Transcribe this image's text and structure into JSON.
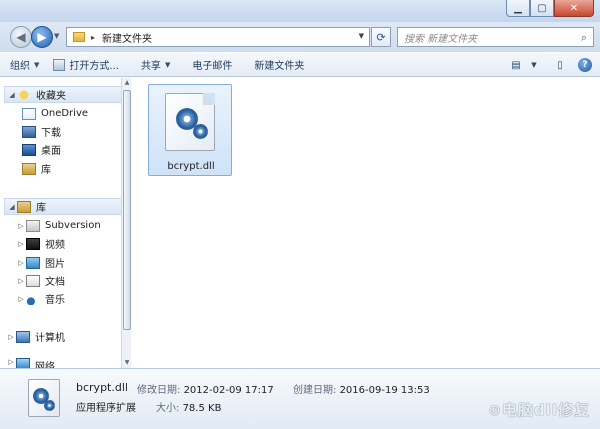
{
  "window": {
    "min_icon": "minimize-icon",
    "max_icon": "maximize-icon",
    "close_icon": "close-icon"
  },
  "nav": {
    "back_icon": "back-arrow-icon",
    "forward_icon": "forward-arrow-icon",
    "address": "新建文件夹",
    "search_placeholder": "搜索 新建文件夹"
  },
  "toolbar": {
    "organize": "组织",
    "open_with": "打开方式...",
    "share": "共享",
    "email": "电子邮件",
    "new_folder": "新建文件夹"
  },
  "sidebar": {
    "favorites_header": "收藏夹",
    "favorites": [
      "OneDrive",
      "下载",
      "桌面",
      "库"
    ],
    "libraries_header": "库",
    "libraries": [
      "Subversion",
      "视频",
      "图片",
      "文档",
      "音乐"
    ],
    "computer": "计算机",
    "network": "网络"
  },
  "files": [
    {
      "name": "bcrypt.dll",
      "icon": "dll-gear-icon"
    }
  ],
  "details": {
    "filename": "bcrypt.dll",
    "type": "应用程序扩展",
    "modified_label": "修改日期:",
    "modified_value": "2012-02-09 17:17",
    "created_label": "创建日期:",
    "created_value": "2016-09-19 13:53",
    "size_label": "大小:",
    "size_value": "78.5 KB"
  },
  "watermark": "⊘电脑dll修复"
}
